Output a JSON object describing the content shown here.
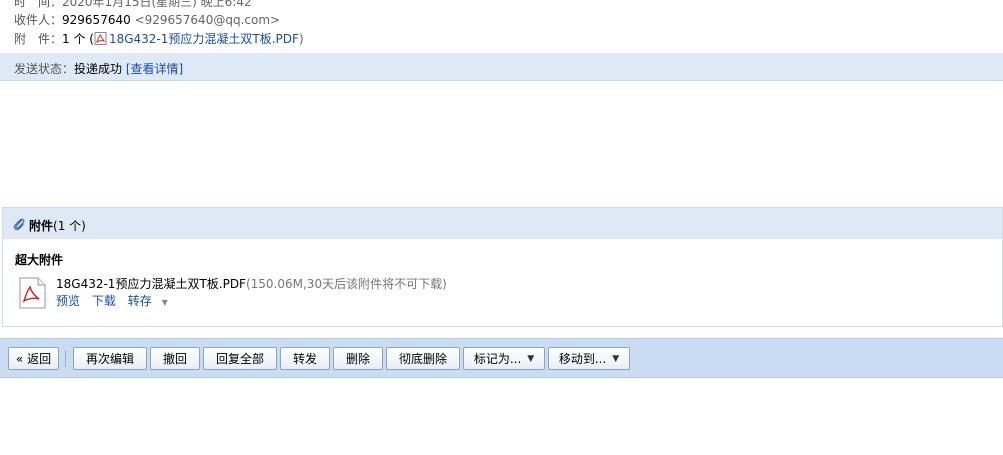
{
  "header": {
    "time_label": "时　间：",
    "time_value": "2020年1月15日(星期三) 晚上6:42",
    "recipient_label": "收件人：",
    "recipient_name": "929657640",
    "recipient_email": "<929657640@qq.com>",
    "attach_label": "附　件：",
    "attach_count": "1 个 (",
    "attach_file": "18G432-1预应力混凝土双T板.PDF",
    "attach_close": ")"
  },
  "status": {
    "label": "发送状态：",
    "value": "投递成功",
    "details_link": "[查看详情]"
  },
  "attachments": {
    "title": "附件",
    "count": "(1 个)",
    "section_label": "超大附件",
    "file": {
      "name": "18G432-1预应力混凝土双T板.PDF",
      "meta": "(150.06M,30天后该附件将不可下载)",
      "actions": [
        "预览",
        "下载",
        "转存"
      ]
    }
  },
  "toolbar": {
    "back": "« 返回",
    "reedit": "再次编辑",
    "recall": "撤回",
    "reply_all": "回复全部",
    "forward": "转发",
    "delete": "删除",
    "delete_perm": "彻底删除",
    "mark_as": "标记为...",
    "move_to": "移动到..."
  },
  "colors": {
    "link": "#1b4ea6",
    "bar_bg": "#dfe9f6",
    "toolbar_bg": "#c9dcf3"
  }
}
